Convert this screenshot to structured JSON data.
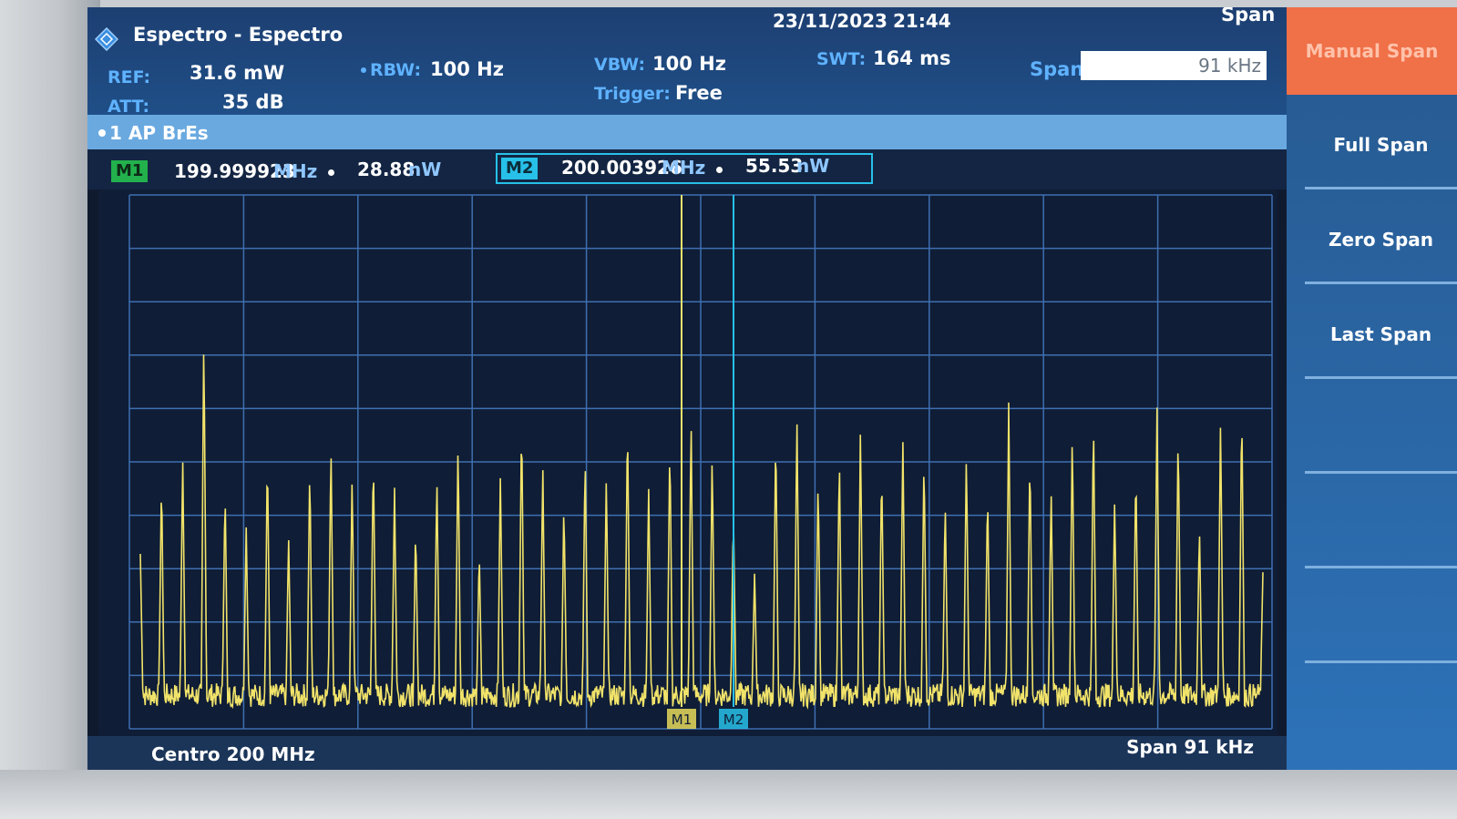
{
  "header": {
    "title": "Espectro - Espectro",
    "date": "23/11/2023",
    "time": "21:44"
  },
  "settings": {
    "ref_label": "REF:",
    "ref_value": "31.6 mW",
    "att_label": "ATT:",
    "att_value": "35 dB",
    "rbw_label": "RBW:",
    "rbw_value": "100 Hz",
    "vbw_label": "VBW:",
    "vbw_value": "100 Hz",
    "trigger_label": "Trigger:",
    "trigger_value": "Free",
    "swt_label": "SWT:",
    "swt_value": "164 ms",
    "span_label": "Span",
    "span_value": "91 kHz"
  },
  "trace": {
    "label": "1 AP BrEs"
  },
  "markers": {
    "m1": {
      "tag": "M1",
      "freq": "199.999923",
      "freq_unit": "MHz",
      "level": "28.88",
      "level_unit": "nW"
    },
    "m2": {
      "tag": "M2",
      "freq": "200.003926",
      "freq_unit": "MHz",
      "level": "55.53",
      "level_unit": "nW"
    }
  },
  "footer": {
    "center": "Centro 200 MHz",
    "span": "Span 91 kHz"
  },
  "softkeys": {
    "title": "Span",
    "items": [
      "Manual Span",
      "Full Span",
      "Zero Span",
      "Last Span"
    ]
  },
  "colors": {
    "trace": "#f1e36a",
    "marker1": "#22b14c",
    "marker2": "#27c0e8",
    "grid": "#3f6fb0",
    "accent": "#f07048"
  },
  "chart_data": {
    "type": "line",
    "xlabel": "Centro 200 MHz",
    "x_range_note": "Span 91 kHz",
    "series": [
      {
        "name": "1 AP BrEs",
        "peaks_relative": [
          0.25,
          0.38,
          0.42,
          0.62,
          0.36,
          0.3,
          0.42,
          0.28,
          0.4,
          0.44,
          0.38,
          0.42,
          0.36,
          0.3,
          0.38,
          0.44,
          0.26,
          0.38,
          0.48,
          0.4,
          0.34,
          0.42,
          0.38,
          0.48,
          0.36,
          0.44,
          0.48,
          0.42,
          0.32,
          0.22,
          0.46,
          0.48,
          0.38,
          0.42,
          0.46,
          0.4,
          0.44,
          0.42,
          0.34,
          0.42,
          0.36,
          0.5,
          0.42,
          0.36,
          0.46,
          0.48,
          0.34,
          0.4,
          0.5,
          0.46,
          0.3,
          0.48,
          0.5,
          0.22
        ]
      }
    ],
    "grid": true
  }
}
